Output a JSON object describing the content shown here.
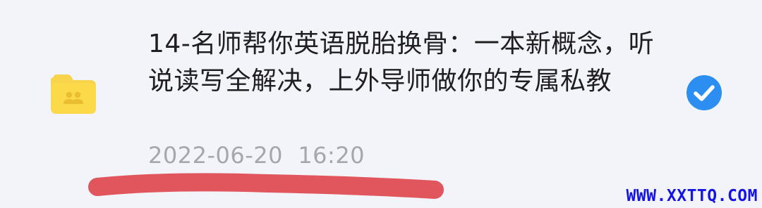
{
  "file_item": {
    "name": "14-名师帮你英语脱胎换骨：一本新概念，听说读写全解决，上外导师做你的专属私教",
    "date": "2022-06-20  16:20",
    "icon": "shared-folder-icon",
    "selected": true,
    "check_icon": "check-circle-icon"
  },
  "watermark": {
    "text": "WWW.XXTTQ.COM"
  },
  "colors": {
    "background": "#f3f4f9",
    "folder": "#f8d44c",
    "check": "#2b8ef0",
    "annotation": "#e0565c",
    "watermark": "#1414e6"
  }
}
